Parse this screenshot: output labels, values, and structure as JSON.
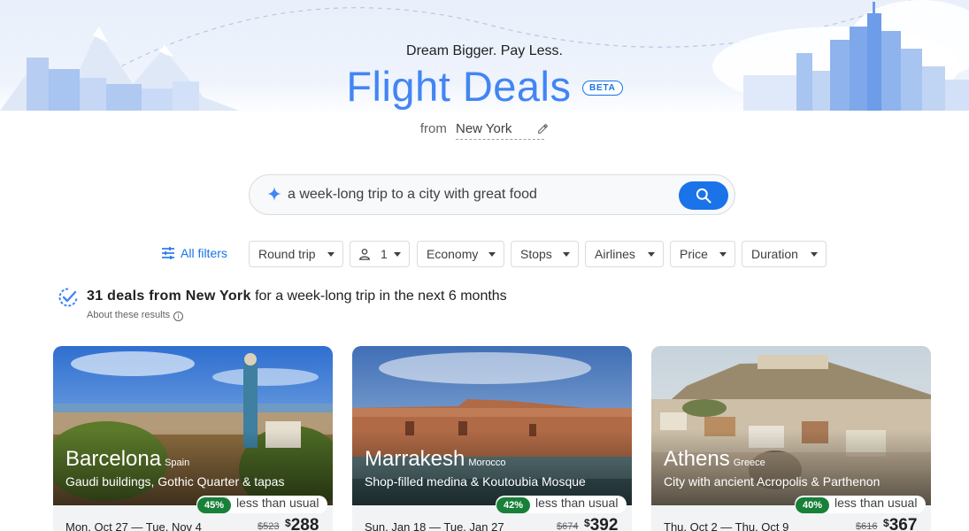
{
  "hero": {
    "tagline": "Dream Bigger. Pay Less.",
    "title": "Flight Deals",
    "badge": "BETA",
    "from_label": "from",
    "from_city": "New York"
  },
  "search": {
    "query": "a week-long trip to a city with great food"
  },
  "filters": {
    "all_filters": "All filters",
    "chips": [
      "Round trip",
      "1",
      "Economy",
      "Stops",
      "Airlines",
      "Price",
      "Duration"
    ]
  },
  "results": {
    "count_bold": "31 deals from New York",
    "rest": " for a week-long trip in the next 6 months",
    "about": "About these results"
  },
  "cards": [
    {
      "city": "Barcelona",
      "country": "Spain",
      "desc": "Gaudi buildings, Gothic Quarter & tapas",
      "pct": "45%",
      "deal_text": "less than usual",
      "dates": "Mon, Oct 27 — Tue, Nov 4",
      "old_price": "$523",
      "currency": "$",
      "price": "288"
    },
    {
      "city": "Marrakesh",
      "country": "Morocco",
      "desc": "Shop-filled medina & Koutoubia Mosque",
      "pct": "42%",
      "deal_text": "less than usual",
      "dates": "Sun, Jan 18 — Tue, Jan 27",
      "old_price": "$674",
      "currency": "$",
      "price": "392"
    },
    {
      "city": "Athens",
      "country": "Greece",
      "desc": "City with ancient Acropolis & Parthenon",
      "pct": "40%",
      "deal_text": "less than usual",
      "dates": "Thu, Oct 2 — Thu, Oct 9",
      "old_price": "$616",
      "currency": "$",
      "price": "367"
    }
  ],
  "colors": {
    "accent": "#1a73e8",
    "title": "#4285f4",
    "deal_green": "#188038"
  }
}
